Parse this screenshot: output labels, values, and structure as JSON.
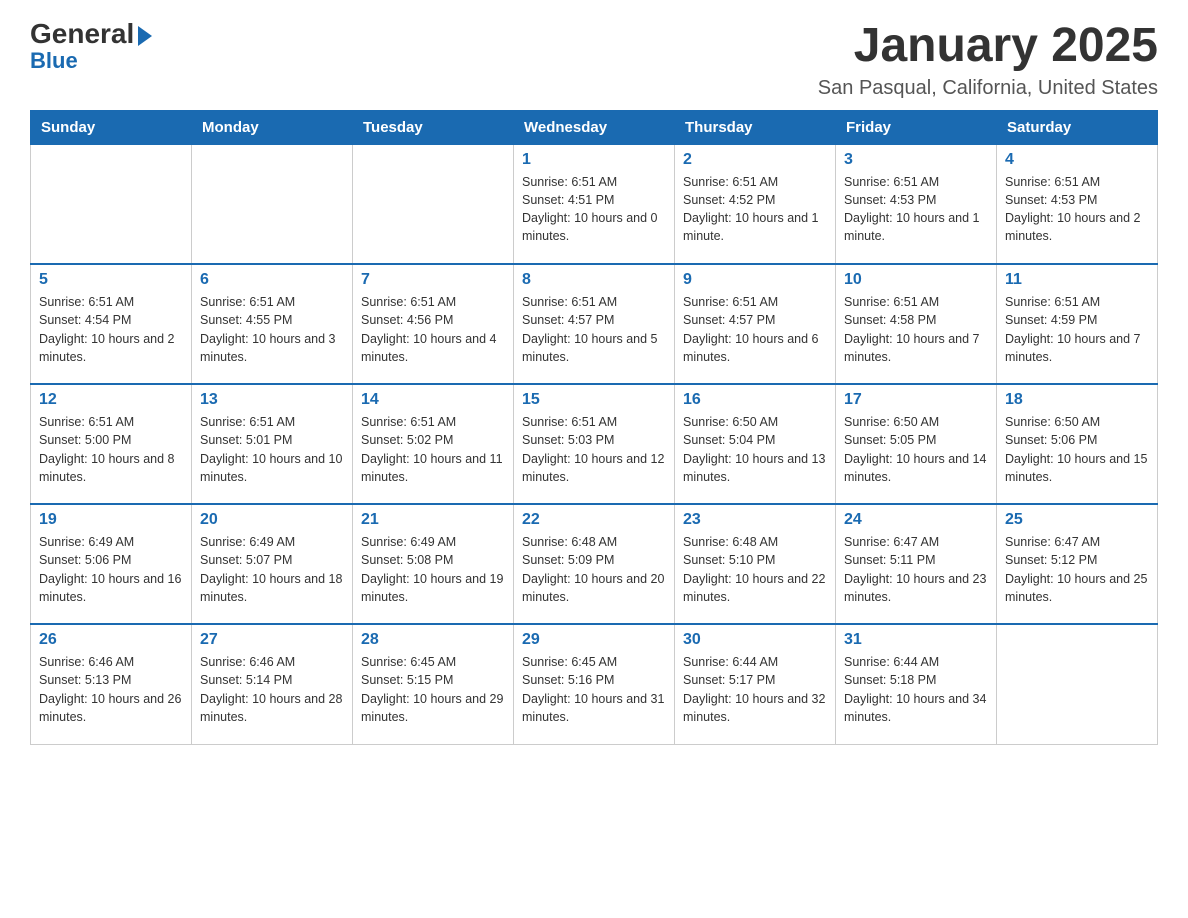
{
  "logo": {
    "general": "General",
    "blue": "Blue",
    "triangle": "▶"
  },
  "header": {
    "month": "January 2025",
    "location": "San Pasqual, California, United States"
  },
  "days_of_week": [
    "Sunday",
    "Monday",
    "Tuesday",
    "Wednesday",
    "Thursday",
    "Friday",
    "Saturday"
  ],
  "weeks": [
    [
      {
        "day": "",
        "info": ""
      },
      {
        "day": "",
        "info": ""
      },
      {
        "day": "",
        "info": ""
      },
      {
        "day": "1",
        "info": "Sunrise: 6:51 AM\nSunset: 4:51 PM\nDaylight: 10 hours and 0 minutes."
      },
      {
        "day": "2",
        "info": "Sunrise: 6:51 AM\nSunset: 4:52 PM\nDaylight: 10 hours and 1 minute."
      },
      {
        "day": "3",
        "info": "Sunrise: 6:51 AM\nSunset: 4:53 PM\nDaylight: 10 hours and 1 minute."
      },
      {
        "day": "4",
        "info": "Sunrise: 6:51 AM\nSunset: 4:53 PM\nDaylight: 10 hours and 2 minutes."
      }
    ],
    [
      {
        "day": "5",
        "info": "Sunrise: 6:51 AM\nSunset: 4:54 PM\nDaylight: 10 hours and 2 minutes."
      },
      {
        "day": "6",
        "info": "Sunrise: 6:51 AM\nSunset: 4:55 PM\nDaylight: 10 hours and 3 minutes."
      },
      {
        "day": "7",
        "info": "Sunrise: 6:51 AM\nSunset: 4:56 PM\nDaylight: 10 hours and 4 minutes."
      },
      {
        "day": "8",
        "info": "Sunrise: 6:51 AM\nSunset: 4:57 PM\nDaylight: 10 hours and 5 minutes."
      },
      {
        "day": "9",
        "info": "Sunrise: 6:51 AM\nSunset: 4:57 PM\nDaylight: 10 hours and 6 minutes."
      },
      {
        "day": "10",
        "info": "Sunrise: 6:51 AM\nSunset: 4:58 PM\nDaylight: 10 hours and 7 minutes."
      },
      {
        "day": "11",
        "info": "Sunrise: 6:51 AM\nSunset: 4:59 PM\nDaylight: 10 hours and 7 minutes."
      }
    ],
    [
      {
        "day": "12",
        "info": "Sunrise: 6:51 AM\nSunset: 5:00 PM\nDaylight: 10 hours and 8 minutes."
      },
      {
        "day": "13",
        "info": "Sunrise: 6:51 AM\nSunset: 5:01 PM\nDaylight: 10 hours and 10 minutes."
      },
      {
        "day": "14",
        "info": "Sunrise: 6:51 AM\nSunset: 5:02 PM\nDaylight: 10 hours and 11 minutes."
      },
      {
        "day": "15",
        "info": "Sunrise: 6:51 AM\nSunset: 5:03 PM\nDaylight: 10 hours and 12 minutes."
      },
      {
        "day": "16",
        "info": "Sunrise: 6:50 AM\nSunset: 5:04 PM\nDaylight: 10 hours and 13 minutes."
      },
      {
        "day": "17",
        "info": "Sunrise: 6:50 AM\nSunset: 5:05 PM\nDaylight: 10 hours and 14 minutes."
      },
      {
        "day": "18",
        "info": "Sunrise: 6:50 AM\nSunset: 5:06 PM\nDaylight: 10 hours and 15 minutes."
      }
    ],
    [
      {
        "day": "19",
        "info": "Sunrise: 6:49 AM\nSunset: 5:06 PM\nDaylight: 10 hours and 16 minutes."
      },
      {
        "day": "20",
        "info": "Sunrise: 6:49 AM\nSunset: 5:07 PM\nDaylight: 10 hours and 18 minutes."
      },
      {
        "day": "21",
        "info": "Sunrise: 6:49 AM\nSunset: 5:08 PM\nDaylight: 10 hours and 19 minutes."
      },
      {
        "day": "22",
        "info": "Sunrise: 6:48 AM\nSunset: 5:09 PM\nDaylight: 10 hours and 20 minutes."
      },
      {
        "day": "23",
        "info": "Sunrise: 6:48 AM\nSunset: 5:10 PM\nDaylight: 10 hours and 22 minutes."
      },
      {
        "day": "24",
        "info": "Sunrise: 6:47 AM\nSunset: 5:11 PM\nDaylight: 10 hours and 23 minutes."
      },
      {
        "day": "25",
        "info": "Sunrise: 6:47 AM\nSunset: 5:12 PM\nDaylight: 10 hours and 25 minutes."
      }
    ],
    [
      {
        "day": "26",
        "info": "Sunrise: 6:46 AM\nSunset: 5:13 PM\nDaylight: 10 hours and 26 minutes."
      },
      {
        "day": "27",
        "info": "Sunrise: 6:46 AM\nSunset: 5:14 PM\nDaylight: 10 hours and 28 minutes."
      },
      {
        "day": "28",
        "info": "Sunrise: 6:45 AM\nSunset: 5:15 PM\nDaylight: 10 hours and 29 minutes."
      },
      {
        "day": "29",
        "info": "Sunrise: 6:45 AM\nSunset: 5:16 PM\nDaylight: 10 hours and 31 minutes."
      },
      {
        "day": "30",
        "info": "Sunrise: 6:44 AM\nSunset: 5:17 PM\nDaylight: 10 hours and 32 minutes."
      },
      {
        "day": "31",
        "info": "Sunrise: 6:44 AM\nSunset: 5:18 PM\nDaylight: 10 hours and 34 minutes."
      },
      {
        "day": "",
        "info": ""
      }
    ]
  ]
}
